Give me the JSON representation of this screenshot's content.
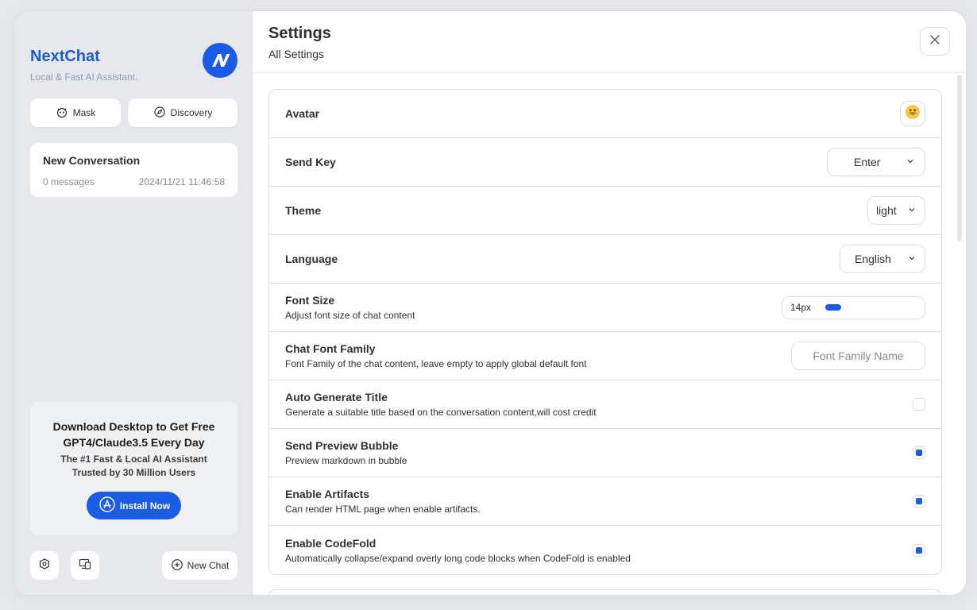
{
  "sidebar": {
    "brand_title": "NextChat",
    "brand_subtitle": "Local & Fast AI Assistant.",
    "mask_label": "Mask",
    "discovery_label": "Discovery",
    "conversation": {
      "title": "New Conversation",
      "count": "0 messages",
      "date": "2024/11/21 11:46:58"
    },
    "promo": {
      "title": "Download Desktop to Get Free GPT4/Claude3.5 Every Day",
      "subtitle": "The #1 Fast & Local AI Assistant Trusted by 30 Million Users",
      "button": "Install Now"
    },
    "new_chat_label": "New Chat"
  },
  "header": {
    "title": "Settings",
    "subtitle": "All Settings"
  },
  "settings": {
    "avatar": {
      "title": "Avatar"
    },
    "send_key": {
      "title": "Send Key",
      "value": "Enter"
    },
    "theme": {
      "title": "Theme",
      "value": "light"
    },
    "language": {
      "title": "Language",
      "value": "English"
    },
    "font_size": {
      "title": "Font Size",
      "subtitle": "Adjust font size of chat content",
      "value": "14px",
      "fill_fraction": 0.18
    },
    "font_family": {
      "title": "Chat Font Family",
      "subtitle": "Font Family of the chat content, leave empty to apply global default font",
      "placeholder": "Font Family Name"
    },
    "auto_title": {
      "title": "Auto Generate Title",
      "subtitle": "Generate a suitable title based on the conversation content,will cost credit",
      "checked": false
    },
    "preview_bubble": {
      "title": "Send Preview Bubble",
      "subtitle": "Preview markdown in bubble",
      "checked": true
    },
    "artifacts": {
      "title": "Enable Artifacts",
      "subtitle": "Can render HTML page when enable artifacts.",
      "checked": true
    },
    "codefold": {
      "title": "Enable CodeFold",
      "subtitle": "Automatically collapse/expand overly long code blocks when CodeFold is enabled",
      "checked": true
    }
  },
  "colors": {
    "accent": "#1a5ce6",
    "brand_text": "#1d5bd6",
    "sidebar_bg": "#e7e8eb"
  }
}
